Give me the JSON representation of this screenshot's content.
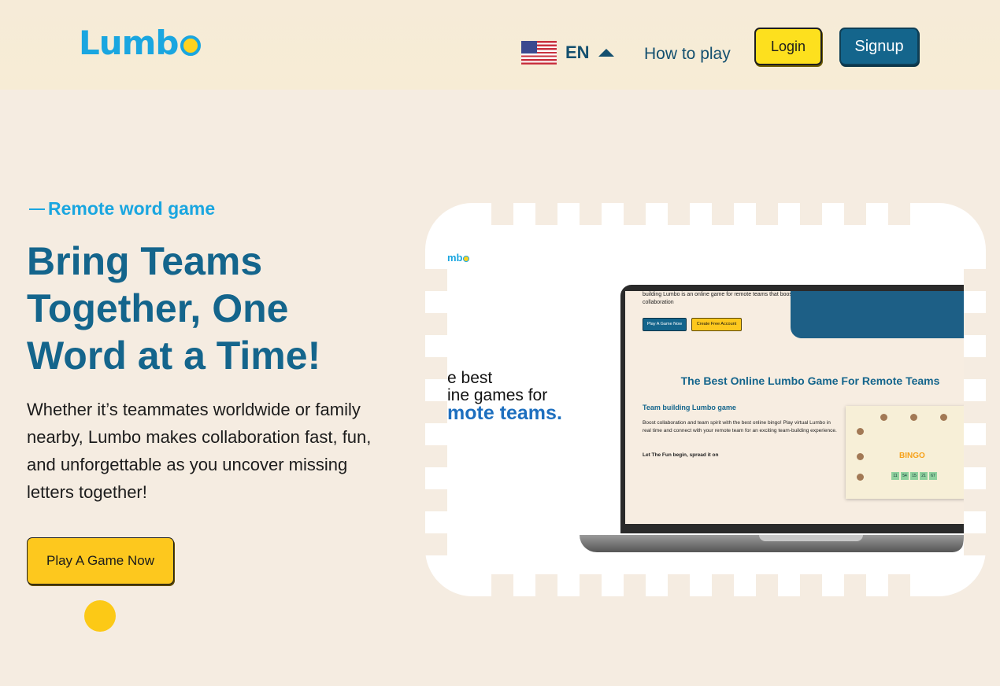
{
  "header": {
    "logo_text": "Lumb",
    "language": {
      "code": "EN"
    },
    "nav": {
      "how_to_play": "How to play"
    },
    "login_label": "Login",
    "signup_label": "Signup"
  },
  "hero": {
    "eyebrow": "Remote word game",
    "title": "Bring Teams Together, One Word at a Time!",
    "description": "Whether it’s teammates worldwide or family nearby, Lumbo makes collaboration fast, fun, and unforgettable as you uncover missing letters together!",
    "cta_label": "Play A Game Now"
  },
  "preview": {
    "mini_logo": "mb",
    "headline_line1": "e best",
    "headline_line2": "ine games for",
    "headline_line3": "mote teams.",
    "screen": {
      "intro": "building Lumbo is an online game for remote teams that boosts collaboration",
      "btn_play": "Play A Game Now",
      "btn_create": "Create Free Account",
      "title": "The Best Online Lumbo Game For Remote Teams",
      "subtitle": "Team building Lumbo game",
      "body": "Boost collaboration and team spirit with the best online bingo! Play virtual Lumbo in real time and connect with your remote team for an exciting team-building experience.",
      "fun": "Let The Fun begin, spread it on",
      "bingo": "BINGO",
      "cells": [
        "11",
        "54",
        "15",
        "21",
        "67"
      ]
    }
  },
  "colors": {
    "brand_blue": "#1aa6e0",
    "primary": "#14658c",
    "accent_yellow": "#fde01e",
    "background": "#f5ece1"
  },
  "icons": {
    "flag": "us-flag-icon",
    "caret": "caret-up-icon"
  }
}
